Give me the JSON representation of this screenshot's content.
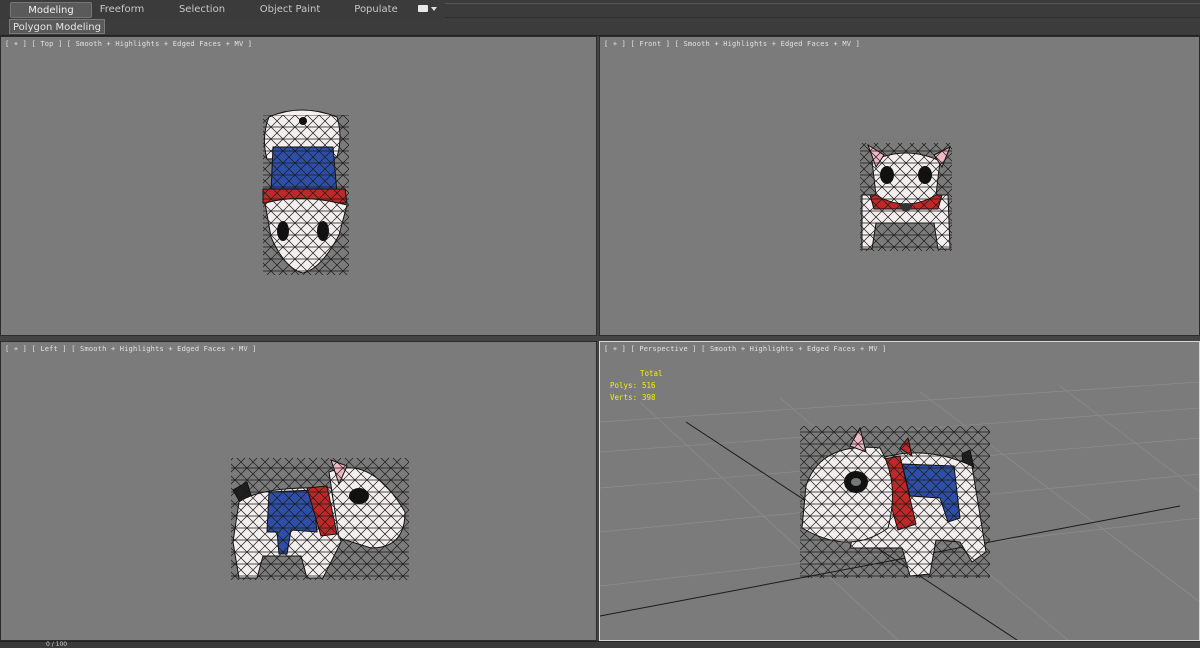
{
  "ribbon": {
    "tabs": [
      {
        "label": "Modeling",
        "active": true
      },
      {
        "label": "Freeform",
        "active": false
      },
      {
        "label": "Selection",
        "active": false
      },
      {
        "label": "Object Paint",
        "active": false
      },
      {
        "label": "Populate",
        "active": false
      }
    ],
    "dropdown_icon": "display-toggle-icon"
  },
  "subpanel": {
    "label": "Polygon Modeling"
  },
  "viewports": {
    "top": {
      "label": "[ + ] [ Top ] [ Smooth + Highlights + Edged Faces + MV ]"
    },
    "front": {
      "label": "[ + ] [ Front ] [ Smooth + Highlights + Edged Faces + MV ]"
    },
    "left": {
      "label": "[ + ] [ Left ] [ Smooth + Highlights + Edged Faces + MV ]"
    },
    "perspective": {
      "label": "[ + ] [ Perspective ] [ Smooth + Highlights + Edged Faces + MV ]",
      "stats": {
        "header": "Total",
        "polys_label": "Polys:",
        "polys": "516",
        "verts_label": "Verts:",
        "verts": "398"
      }
    }
  },
  "timeline": {
    "frame": "0 / 100"
  },
  "colors": {
    "viewport_bg": "#7b7b7b",
    "stats_text": "#f2f200",
    "saddle_blue": "#2e4fa8",
    "collar_red": "#c02828",
    "body_white": "#f4eeee"
  }
}
